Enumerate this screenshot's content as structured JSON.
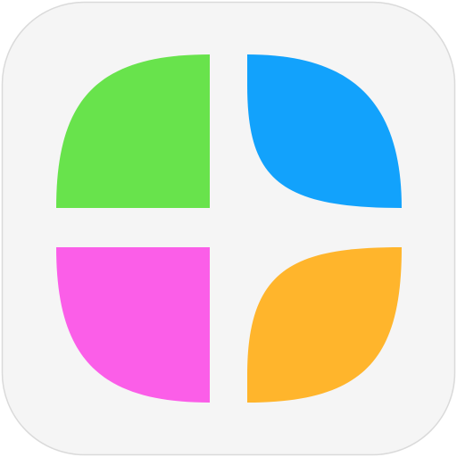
{
  "icon": {
    "background_color": "#F5F5F5",
    "border_color": "#DADADA",
    "petals": [
      {
        "name": "petal-top-left",
        "color": "#68E34C"
      },
      {
        "name": "petal-top-right",
        "color": "#12A2FC"
      },
      {
        "name": "petal-bottom-left",
        "color": "#FB5EE8"
      },
      {
        "name": "petal-bottom-right",
        "color": "#FFB52C"
      }
    ]
  }
}
